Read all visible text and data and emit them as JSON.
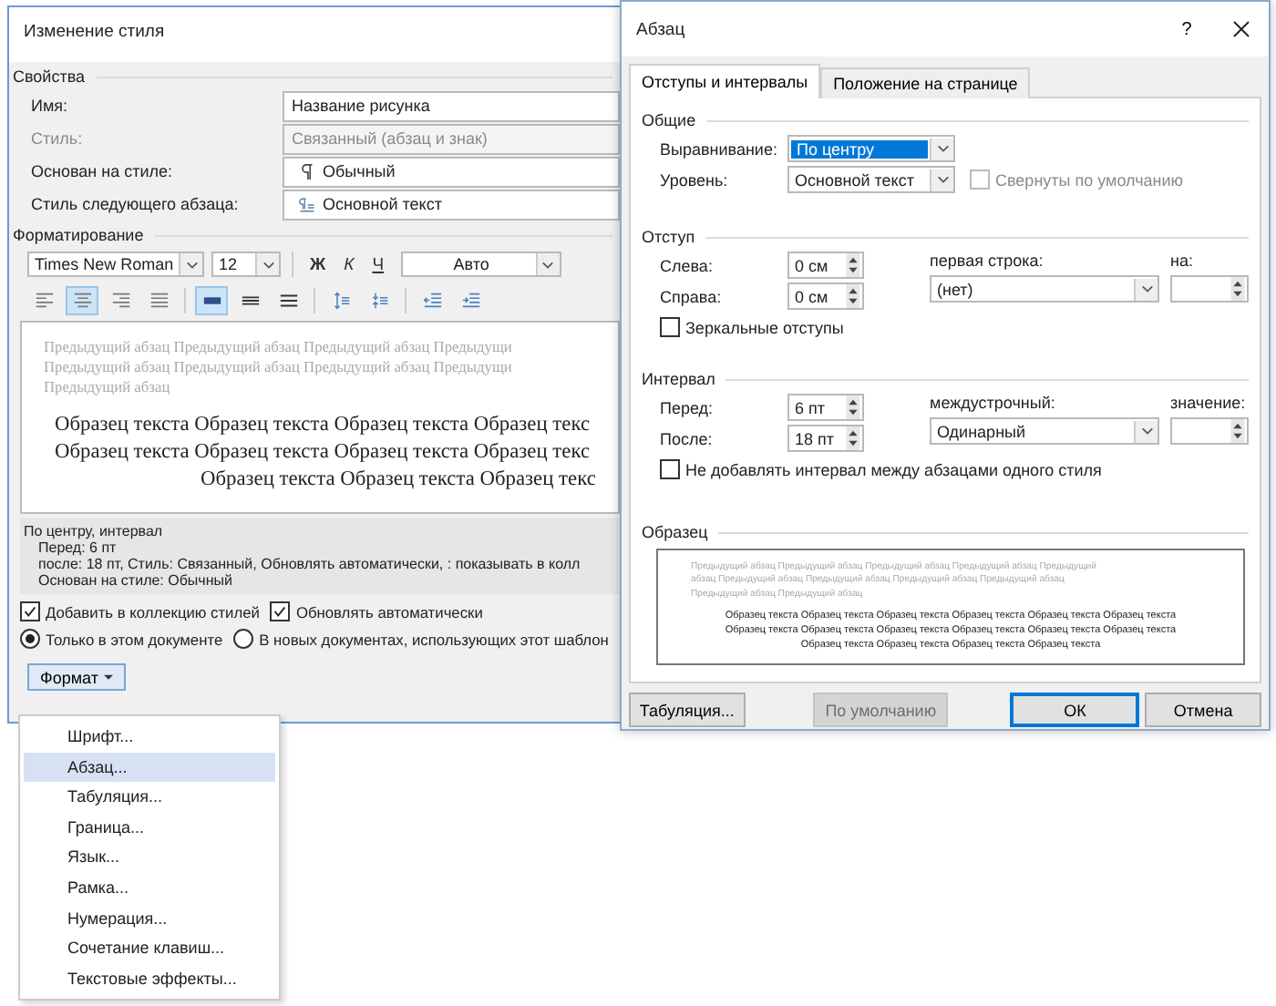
{
  "style_dialog": {
    "title": "Изменение стиля",
    "properties_heading": "Свойства",
    "properties": [
      {
        "label": "Имя:",
        "value": "Название рисунка",
        "kind": "text",
        "disabled": false
      },
      {
        "label": "Стиль:",
        "value": "Связанный (абзац и знак)",
        "kind": "text",
        "disabled": true
      },
      {
        "label": "Основан на стиле:",
        "value": "Обычный",
        "kind": "paragraph",
        "disabled": false
      },
      {
        "label": "Стиль следующего абзаца:",
        "value": "Основной текст",
        "kind": "linked",
        "disabled": false
      }
    ],
    "formatting_heading": "Форматирование",
    "font": "Times New Roman",
    "size": "12",
    "char_buttons": [
      {
        "label": "Ж",
        "kind": "bold"
      },
      {
        "label": "К",
        "kind": "italic"
      },
      {
        "label": "Ч",
        "kind": "underline"
      }
    ],
    "font_color": "Авто",
    "align_buttons": [
      {
        "selected": false
      },
      {
        "selected": true
      },
      {
        "selected": false
      },
      {
        "selected": false
      }
    ],
    "spacing_buttons": [
      {
        "selected": true
      },
      {
        "selected": false
      },
      {
        "selected": false
      }
    ],
    "preview": {
      "previous": [
        "Предыдущий абзац Предыдущий абзац Предыдущий абзац Предыдущи",
        "Предыдущий абзац Предыдущий абзац Предыдущий абзац Предыдущи",
        "Предыдущий абзац"
      ],
      "sample": [
        "Образец текста Образец текста Образец текста Образец текс",
        "Образец текста Образец текста Образец текста Образец текс",
        "Образец текста Образец текста Образец текс"
      ]
    },
    "description": [
      "По центру, интервал",
      "Перед:  6 пт",
      "после: 18 пт, Стиль: Связанный, Обновлять автоматически, : показывать в колл",
      "Основан на стиле: Обычный"
    ],
    "checkboxes": [
      {
        "label": "Добавить в коллекцию стилей",
        "checked": true
      },
      {
        "label": "Обновлять автоматически",
        "checked": true
      }
    ],
    "radios": [
      {
        "label": "Только в этом документе",
        "selected": true
      },
      {
        "label": "В новых документах, использующих этот шаблон",
        "selected": false
      }
    ],
    "format_button": "Формат"
  },
  "format_menu": [
    {
      "label": "Шрифт...",
      "selected": false
    },
    {
      "label": "Абзац...",
      "selected": true
    },
    {
      "label": "Табуляция...",
      "selected": false
    },
    {
      "label": "Граница...",
      "selected": false
    },
    {
      "label": "Язык...",
      "selected": false
    },
    {
      "label": "Рамка...",
      "selected": false
    },
    {
      "label": "Нумерация...",
      "selected": false
    },
    {
      "label": "Сочетание клавиш...",
      "selected": false
    },
    {
      "label": "Текстовые эффекты...",
      "selected": false
    }
  ],
  "paragraph_dialog": {
    "title": "Абзац",
    "help": "?",
    "tabs": [
      {
        "label": "Отступы и интервалы",
        "selected": true
      },
      {
        "label": "Положение на странице",
        "selected": false
      }
    ],
    "general": {
      "heading": "Общие",
      "alignment_label": "Выравнивание:",
      "alignment": "По центру",
      "alignment_highlighted": true,
      "level_label": "Уровень:",
      "level": "Основной текст",
      "collapsed": {
        "label": "Свернуты по умолчанию",
        "checked": false,
        "disabled": true
      }
    },
    "indent": {
      "heading": "Отступ",
      "left_label": "Слева:",
      "left": "0 см",
      "right_label": "Справа:",
      "right": "0 см",
      "first_line_label": "первая строка:",
      "first_line": "(нет)",
      "by_label": "на:",
      "mirror": {
        "label": "Зеркальные отступы",
        "checked": false
      }
    },
    "spacing": {
      "heading": "Интервал",
      "before_label": "Перед:",
      "before": "6 пт",
      "after_label": "После:",
      "after": "18 пт",
      "line_label": "междустрочный:",
      "line": "Одинарный",
      "value_label": "значение:",
      "dont_add": {
        "label": "Не добавлять интервал между абзацами одного стиля",
        "checked": false
      }
    },
    "sample": {
      "heading": "Образец",
      "previous": [
        "Предыдущий абзац Предыдущий абзац Предыдущий абзац Предыдущий абзац Предыдущий",
        "абзац Предыдущий абзац Предыдущий абзац Предыдущий абзац Предыдущий абзац",
        "Предыдущий абзац Предыдущий абзац"
      ],
      "lines": [
        "Образец текста Образец текста Образец текста Образец текста Образец текста Образец текста",
        "Образец текста Образец текста Образец текста Образец текста Образец текста Образец текста",
        "Образец текста Образец текста Образец текста Образец текста"
      ]
    },
    "buttons": [
      {
        "label": "Табуляция...",
        "kind": "normal"
      },
      {
        "label": "По умолчанию",
        "kind": "disabled"
      },
      {
        "label": "ОК",
        "kind": "default"
      },
      {
        "label": "Отмена",
        "kind": "normal"
      }
    ]
  }
}
